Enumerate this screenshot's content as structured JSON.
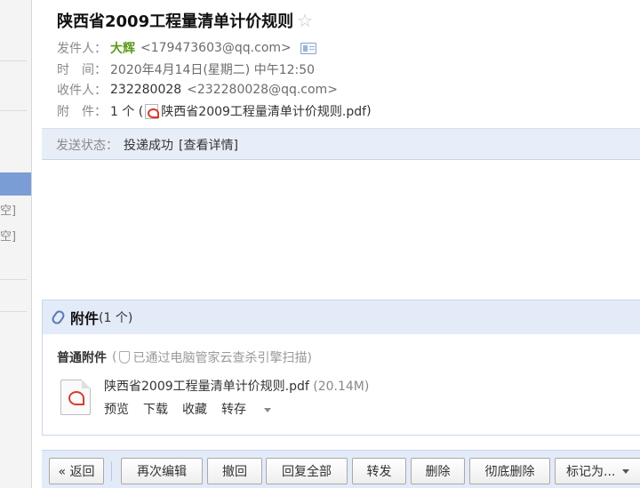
{
  "sidebar": {
    "clear_label_1": "清空]",
    "clear_label_2": "清空]"
  },
  "mail": {
    "subject": "陕西省2009工程量清单计价规则",
    "star_icon": "☆",
    "sender_label": "发件人：",
    "sender_name": "大辉",
    "sender_email": "<179473603@qq.com>",
    "time_label": "时　间：",
    "time_value": "2020年4月14日(星期二) 中午12:50",
    "recipient_label": "收件人：",
    "recipient_value": "232280028",
    "recipient_email": "<232280028@qq.com>",
    "attachment_label": "附　件：",
    "attachment_count": "1 个 (",
    "attachment_name": "陕西省2009工程量清单计价规则.pdf",
    "attachment_close": ")",
    "status_label": "发送状态：",
    "status_value": "投递成功",
    "status_details": "[查看详情]"
  },
  "attachments_panel": {
    "title": "附件",
    "count": "(1 个)",
    "normal_label": "普通附件",
    "scan_prefix": "(",
    "scan_text": "已通过电脑管家云查杀引擎扫描)",
    "file_name": "陕西省2009工程量清单计价规则.pdf",
    "file_size": "(20.14M)",
    "actions": {
      "preview": "预览",
      "download": "下载",
      "favorite": "收藏",
      "save_to": "转存"
    }
  },
  "toolbar": {
    "back": "« 返回",
    "re_edit": "再次编辑",
    "recall": "撤回",
    "reply_all": "回复全部",
    "forward": "转发",
    "delete": "删除",
    "delete_permanently": "彻底删除",
    "mark_as": "标记为..."
  },
  "colors": {
    "accent": "#7b9dd6",
    "sender_green": "#5c9a1b",
    "panel_blue": "#e3ebf8",
    "pdf_red": "#d83a2e"
  }
}
